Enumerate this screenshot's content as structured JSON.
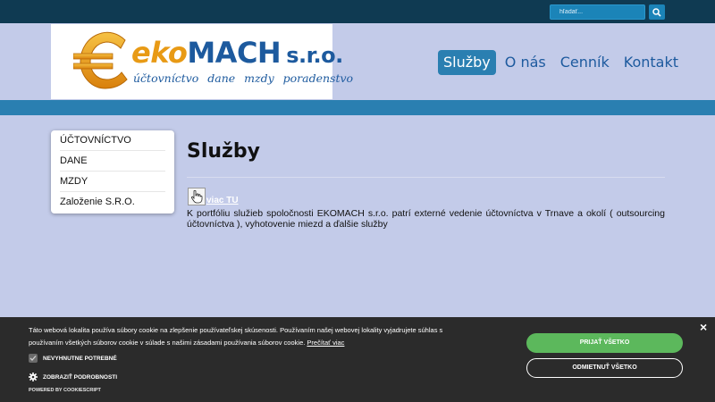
{
  "search": {
    "placeholder": "hľadať..."
  },
  "logo": {
    "eko": "eko",
    "mach": "MACH",
    "sro": "s.r.o.",
    "tagline": "účtovníctvo dane mzdy poradenstvo"
  },
  "nav": [
    {
      "label": "Služby",
      "active": true
    },
    {
      "label": "O nás",
      "active": false
    },
    {
      "label": "Cenník",
      "active": false
    },
    {
      "label": "Kontakt",
      "active": false
    }
  ],
  "sidebar": {
    "items": [
      {
        "label": "ÚČTOVNÍCTVO"
      },
      {
        "label": "DANE"
      },
      {
        "label": "MZDY"
      },
      {
        "label": "Založenie S.R.O."
      }
    ]
  },
  "main": {
    "title": "Služby",
    "more_link": "viac TU",
    "intro": "K portfóliu služieb spoločnosti EKOMACH s.r.o. patrí externé vedenie účtovníctva v Trnave a okolí ( outsourcing účtovníctva ), vyhotovenie miezd a ďalšie služby"
  },
  "cookie": {
    "text": "Táto webová lokalita používa súbory cookie na zlepšenie používateľskej skúsenosti. Používaním našej webovej lokality vyjadrujete súhlas s používaním všetkých súborov cookie v súlade s našimi zásadami používania súborov cookie.",
    "more": "Prečítať viac",
    "necessary": "NEVYHNUTNE POTREBNÉ",
    "details": "ZOBRAZIŤ PODROBNOSTI",
    "powered": "POWERED BY COOKIESCRIPT",
    "accept": "PRIJAŤ VŠETKO",
    "reject": "ODMIETNUŤ VŠETKO",
    "close": "×",
    "accept_color": "#5cb85c"
  },
  "colors": {
    "topbar": "#0f3a52",
    "accent": "#2a7fb1",
    "background": "#c3cbe9",
    "brand_orange": "#e89a15",
    "brand_blue": "#1d5a9e"
  }
}
